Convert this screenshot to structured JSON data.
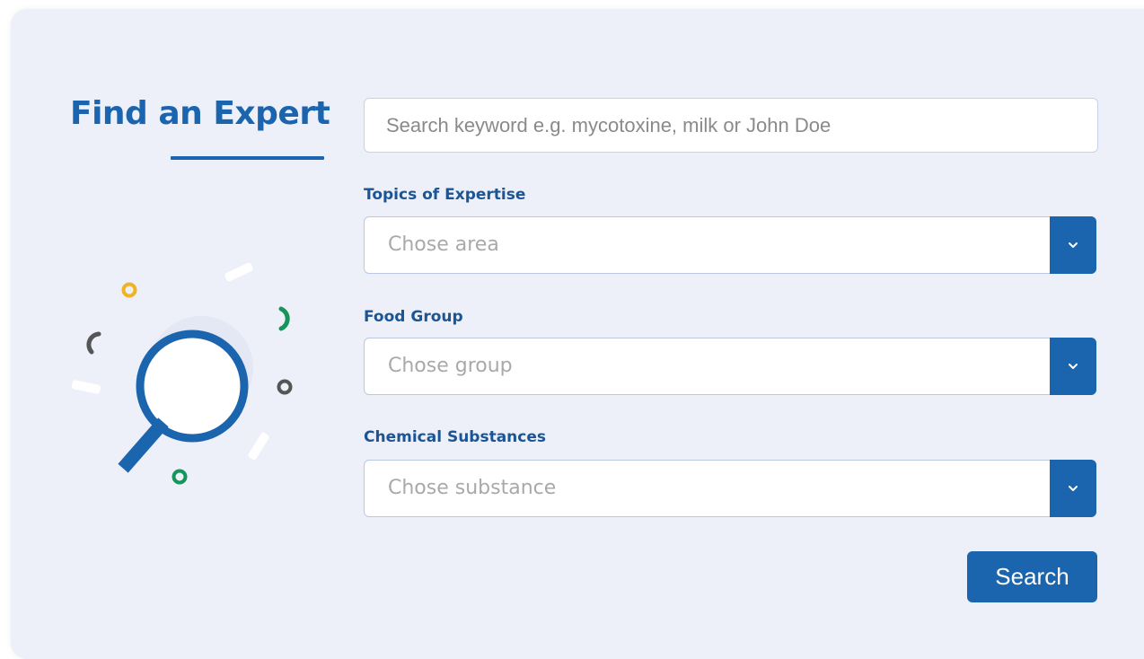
{
  "header": {
    "title": "Find an Expert"
  },
  "search": {
    "placeholder": "Search keyword e.g. mycotoxine, milk or John Doe"
  },
  "filters": [
    {
      "label": "Topics of Expertise",
      "placeholder": "Chose area"
    },
    {
      "label": "Food Group",
      "placeholder": "Chose group"
    },
    {
      "label": "Chemical Substances",
      "placeholder": "Chose substance"
    }
  ],
  "actions": {
    "search_label": "Search"
  },
  "icons": {
    "illustration": "magnifier-icon",
    "dropdown": "chevron-down-icon"
  },
  "colors": {
    "brand": "#1b64ae",
    "background": "#edf0f9",
    "accent_yellow": "#f0b323",
    "accent_green": "#16955a",
    "accent_gray": "#555555"
  }
}
